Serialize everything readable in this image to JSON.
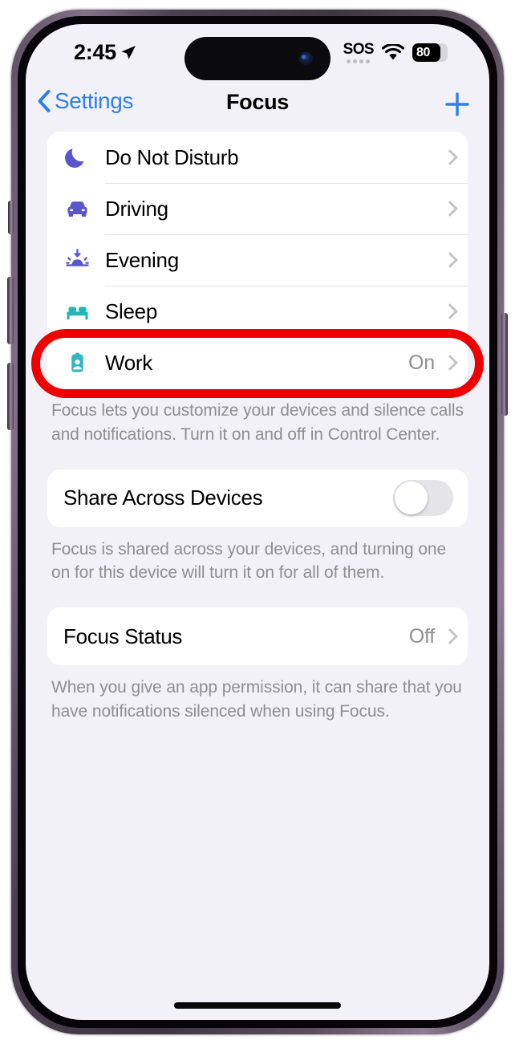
{
  "status_bar": {
    "time": "2:45",
    "location_icon": "location-arrow-icon",
    "sos_label": "SOS",
    "cellular_icon": "cellular-dots-icon",
    "wifi_icon": "wifi-icon",
    "battery_percent": "80",
    "battery_level": 80
  },
  "nav": {
    "back_label": "Settings",
    "back_icon": "chevron-left-icon",
    "title": "Focus",
    "add_icon": "plus-icon"
  },
  "focus_list": {
    "items": [
      {
        "label": "Do Not Disturb",
        "icon": "moon-icon",
        "icon_color": "#5a55cf",
        "value": "",
        "highlighted": false
      },
      {
        "label": "Driving",
        "icon": "car-icon",
        "icon_color": "#5a55cf",
        "value": "",
        "highlighted": false
      },
      {
        "label": "Evening",
        "icon": "sunset-icon",
        "icon_color": "#5a55cf",
        "value": "",
        "highlighted": false
      },
      {
        "label": "Sleep",
        "icon": "bed-icon",
        "icon_color": "#1fb6b6",
        "value": "",
        "highlighted": true
      },
      {
        "label": "Work",
        "icon": "badge-icon",
        "icon_color": "#34b6c9",
        "value": "On",
        "highlighted": false
      }
    ],
    "footer": "Focus lets you customize your devices and silence calls and notifications. Turn it on and off in Control Center."
  },
  "share_section": {
    "label": "Share Across Devices",
    "toggle_on": false,
    "footer": "Focus is shared across your devices, and turning one on for this device will turn it on for all of them."
  },
  "status_section": {
    "label": "Focus Status",
    "value": "Off",
    "footer": "When you give an app permission, it can share that you have notifications silenced when using Focus."
  },
  "annotation": {
    "shape": "red-oval-highlight",
    "color": "#ef0000",
    "targets": "Sleep"
  },
  "colors": {
    "accent_blue": "#2d7ff0",
    "page_background": "#f2f1f7",
    "card_background": "#ffffff",
    "secondary_text": "#8e8e93"
  }
}
